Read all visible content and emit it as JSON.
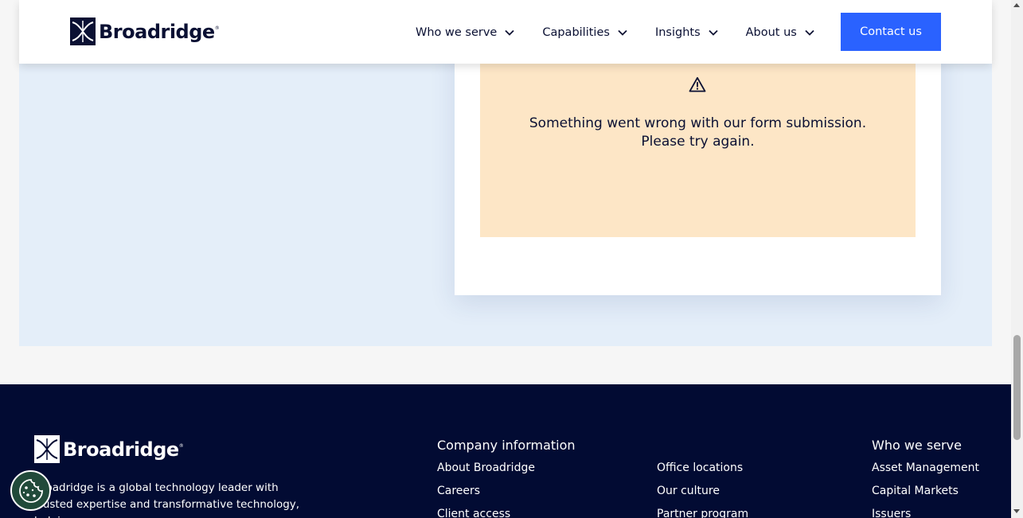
{
  "header": {
    "logo_text": "Broadridge",
    "logo_reg": "®",
    "nav": [
      {
        "label": "Who we serve",
        "icon": "chevron-down-icon"
      },
      {
        "label": "Capabilities",
        "icon": "chevron-down-icon"
      },
      {
        "label": "Insights",
        "icon": "chevron-down-icon"
      },
      {
        "label": "About us",
        "icon": "chevron-down-icon"
      }
    ],
    "contact_label": "Contact us"
  },
  "form": {
    "error_icon": "warning-icon",
    "error_line1": "Something went wrong with our form submission.",
    "error_line2": "Please try again."
  },
  "footer": {
    "logo_text": "Broadridge",
    "logo_reg": "®",
    "about": "Broadridge is a global technology leader with trusted expertise and transformative technology, helping our",
    "company_title": "Company information",
    "company_links_col1": [
      "About Broadridge",
      "Careers",
      "Client access"
    ],
    "company_links_col2": [
      "Office locations",
      "Our culture",
      "Partner program"
    ],
    "serve_title": "Who we serve",
    "serve_links": [
      "Asset Management",
      "Capital Markets",
      "Issuers"
    ]
  },
  "cookie": {
    "icon": "cookie-icon"
  },
  "colors": {
    "brand_navy": "#0a1033",
    "accent_blue": "#2a62ff",
    "footer_bg": "#020b33",
    "error_bg": "#fde6c6",
    "section_bg": "#e4eef9"
  }
}
